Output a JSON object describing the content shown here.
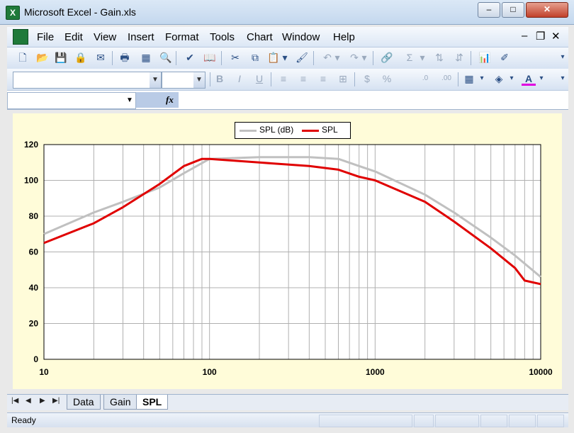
{
  "window": {
    "title": "Microsoft Excel - Gain.xls",
    "minimize": "–",
    "maximize": "□",
    "close": "✕"
  },
  "menu": {
    "items": [
      "File",
      "Edit",
      "View",
      "Insert",
      "Format",
      "Tools",
      "Chart",
      "Window",
      "Help"
    ],
    "minimize": "–",
    "restore": "❐",
    "close": "✕"
  },
  "formula_bar": {
    "fx": "fx"
  },
  "chart_data": {
    "type": "line",
    "xscale": "log",
    "xlim": [
      10,
      10000
    ],
    "ylim": [
      0,
      120
    ],
    "yticks": [
      "0",
      "20",
      "40",
      "60",
      "80",
      "100",
      "120"
    ],
    "xticks": [
      "10",
      "100",
      "1000",
      "10000"
    ],
    "grid": true,
    "legend": "top",
    "series": [
      {
        "name": "SPL (dB)",
        "color": "#c0c0c0",
        "x": [
          10,
          20,
          30,
          50,
          70,
          100,
          200,
          400,
          600,
          800,
          1000,
          2000,
          3000,
          5000,
          7000,
          10000
        ],
        "y": [
          70,
          82,
          88,
          96,
          104,
          112,
          113,
          113,
          112,
          108,
          105,
          92,
          82,
          68,
          58,
          46
        ]
      },
      {
        "name": "SPL",
        "color": "#e00000",
        "x": [
          10,
          20,
          30,
          50,
          70,
          90,
          100,
          200,
          400,
          600,
          800,
          1000,
          2000,
          3000,
          5000,
          7000,
          8000,
          10000
        ],
        "y": [
          65,
          76,
          85,
          98,
          108,
          112,
          112,
          110,
          108,
          106,
          102,
          100,
          88,
          77,
          62,
          51,
          44,
          42
        ]
      }
    ]
  },
  "sheet_tabs": {
    "tabs": [
      "Data",
      "Gain",
      "SPL"
    ],
    "active": "SPL"
  },
  "status": {
    "text": "Ready"
  }
}
